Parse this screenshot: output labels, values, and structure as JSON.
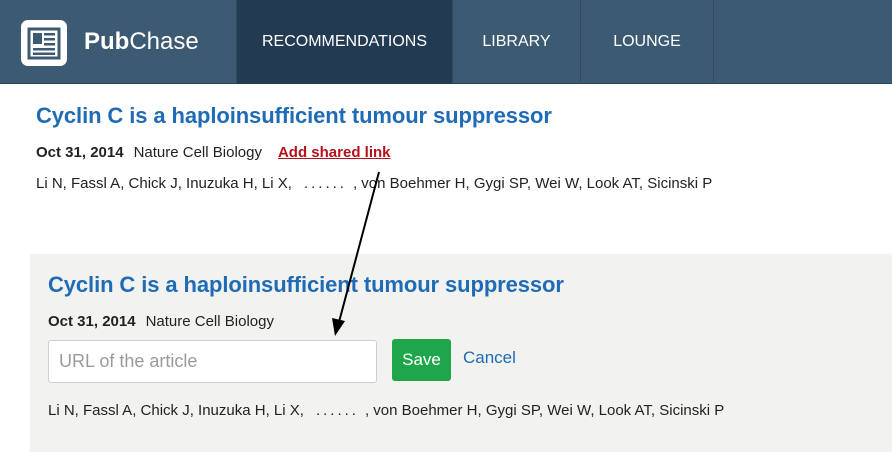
{
  "app": {
    "brand_bold": "Pub",
    "brand_light": "Chase",
    "logo_icon": "newspaper-icon"
  },
  "nav": {
    "tabs": [
      {
        "label": "RECOMMENDATIONS",
        "active": true
      },
      {
        "label": "LIBRARY",
        "active": false
      },
      {
        "label": "LOUNGE",
        "active": false
      }
    ]
  },
  "article": {
    "title": "Cyclin C is a haploinsufficient tumour suppressor",
    "date": "Oct 31, 2014",
    "journal": "Nature Cell Biology",
    "authors_first": "Li N, Fassl A, Chick J, Inuzuka H, Li X,",
    "authors_ellipsis": "......",
    "authors_last": ", von Boehmer H, Gygi SP, Wei W, Look AT, Sicinski P"
  },
  "actions": {
    "add_shared_link": "Add shared link"
  },
  "edit_form": {
    "url_placeholder": "URL of the article",
    "url_value": "",
    "save_label": "Save",
    "cancel_label": "Cancel"
  },
  "colors": {
    "nav_bg": "#3d5a73",
    "nav_active": "#233b52",
    "title_blue": "#1f6bb5",
    "link_red": "#b5121b",
    "save_green": "#1fa64a",
    "panel_bg": "#f2f2f0"
  }
}
